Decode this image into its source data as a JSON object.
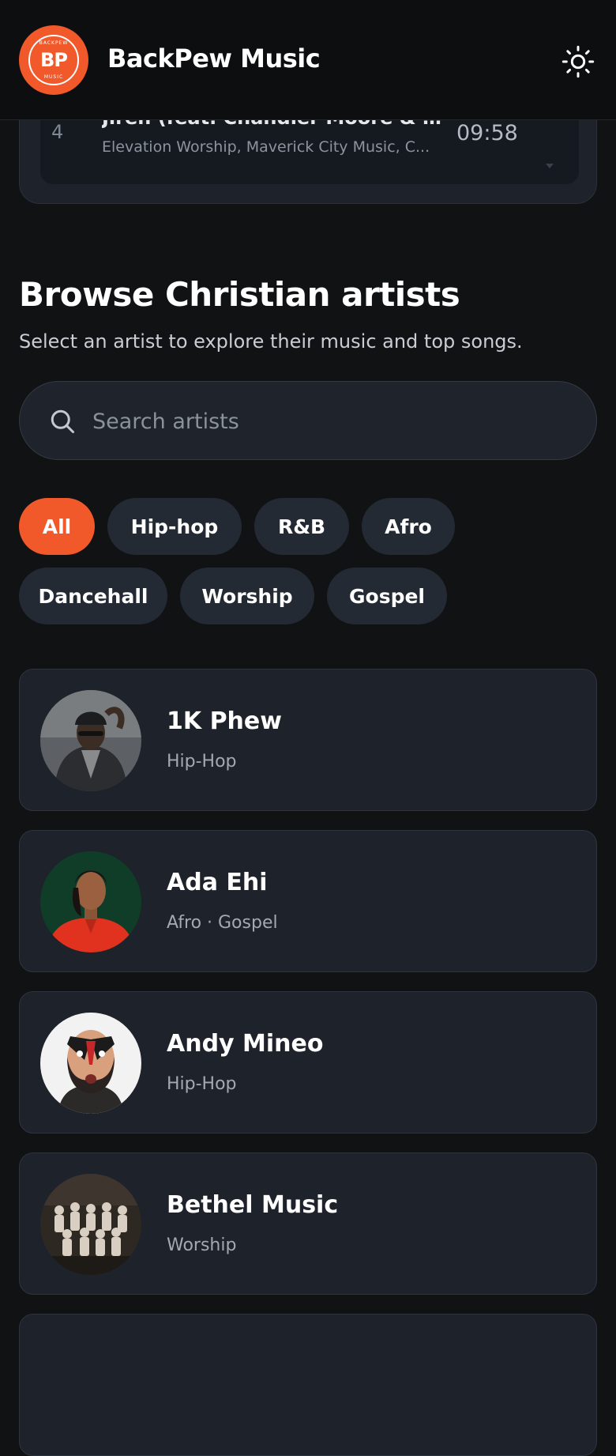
{
  "header": {
    "app_name": "BackPew Music",
    "logo_mark": "BP",
    "logo_ring_top": "BACKPEW",
    "logo_ring_bottom": "MUSIC",
    "theme_icon": "sun-icon"
  },
  "queue": {
    "track": {
      "number": "4",
      "title": "Jireh (feat. Chandler Moore & Na...",
      "artists": "Elevation Worship, Maverick City Music, C...",
      "duration": "09:58"
    }
  },
  "browse": {
    "title": "Browse Christian artists",
    "subtitle": "Select an artist to explore their music and top songs."
  },
  "search": {
    "placeholder": "Search artists",
    "value": "",
    "icon": "search-icon"
  },
  "filters": [
    {
      "label": "All",
      "active": true
    },
    {
      "label": "Hip-hop",
      "active": false
    },
    {
      "label": "R&B",
      "active": false
    },
    {
      "label": "Afro",
      "active": false
    },
    {
      "label": "Dancehall",
      "active": false
    },
    {
      "label": "Worship",
      "active": false
    },
    {
      "label": "Gospel",
      "active": false
    }
  ],
  "artists": [
    {
      "name": "1K Phew",
      "genre": "Hip-Hop"
    },
    {
      "name": "Ada Ehi",
      "genre": "Afro · Gospel"
    },
    {
      "name": "Andy Mineo",
      "genre": "Hip-Hop"
    },
    {
      "name": "Bethel Music",
      "genre": "Worship"
    }
  ],
  "colors": {
    "accent": "#f1592a",
    "background": "#111214",
    "card": "#1e232b",
    "chip": "#232a34"
  }
}
